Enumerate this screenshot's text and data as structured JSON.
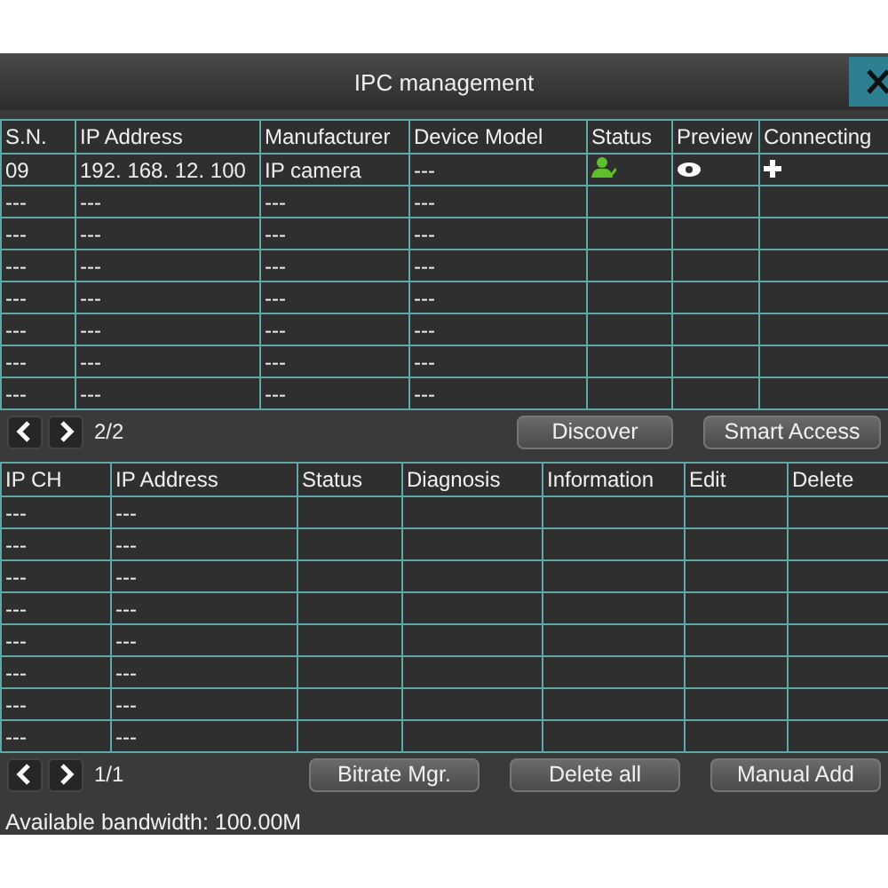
{
  "window": {
    "title": "IPC management"
  },
  "device_table": {
    "columns": [
      "S.N.",
      "IP Address",
      "Manufacturer",
      "Device Model",
      "Status",
      "Preview",
      "Connecting"
    ],
    "rows": [
      {
        "kind": "device",
        "cells": [
          "09",
          "192. 168. 12. 100",
          "IP camera",
          "---"
        ]
      },
      {
        "kind": "empty",
        "cells": [
          "---",
          "---",
          "---",
          "---"
        ]
      },
      {
        "kind": "empty",
        "cells": [
          "---",
          "---",
          "---",
          "---"
        ]
      },
      {
        "kind": "empty",
        "cells": [
          "---",
          "---",
          "---",
          "---"
        ]
      },
      {
        "kind": "empty",
        "cells": [
          "---",
          "---",
          "---",
          "---"
        ]
      },
      {
        "kind": "empty",
        "cells": [
          "---",
          "---",
          "---",
          "---"
        ]
      },
      {
        "kind": "empty",
        "cells": [
          "---",
          "---",
          "---",
          "---"
        ]
      },
      {
        "kind": "empty",
        "cells": [
          "---",
          "---",
          "---",
          "---"
        ]
      }
    ]
  },
  "device_pager": {
    "page": "2/2",
    "buttons": [
      "Discover",
      "Smart Access"
    ]
  },
  "channel_table": {
    "columns": [
      "IP CH",
      "IP Address",
      "Status",
      "Diagnosis",
      "Information",
      "Edit",
      "Delete"
    ],
    "rows": [
      {
        "cells": [
          "---",
          "---"
        ]
      },
      {
        "cells": [
          "---",
          "---"
        ]
      },
      {
        "cells": [
          "---",
          "---"
        ]
      },
      {
        "cells": [
          "---",
          "---"
        ]
      },
      {
        "cells": [
          "---",
          "---"
        ]
      },
      {
        "cells": [
          "---",
          "---"
        ]
      },
      {
        "cells": [
          "---",
          "---"
        ]
      },
      {
        "cells": [
          "---",
          "---"
        ]
      }
    ]
  },
  "channel_pager": {
    "page": "1/1",
    "buttons": [
      "Bitrate Mgr.",
      "Delete all",
      "Manual Add"
    ]
  },
  "status_bar": "Available bandwidth: 100.00M"
}
